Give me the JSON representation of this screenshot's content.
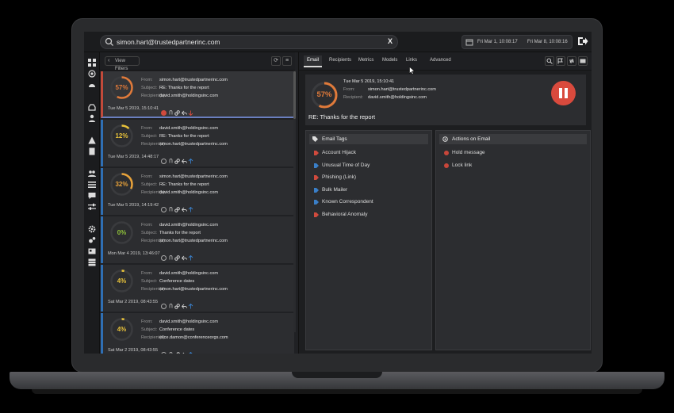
{
  "search": {
    "value": "simon.hart@trustedpartnerinc.com",
    "clear_label": "X"
  },
  "date_range": {
    "from": "Fri Mar 1, 10:08:17",
    "to": "Fri Mar 8, 10:08:16"
  },
  "list": {
    "filter_label": "View Filters",
    "refresh_label": "⟳",
    "menu_label": "≡",
    "labels": {
      "from": "From:",
      "subject": "Subject:",
      "recipients": "Recipient(s):"
    },
    "emails": [
      {
        "score": "57%",
        "score_value": 57,
        "color": "#e07a3a",
        "from": "simon.hart@trustedpartnerinc.com",
        "subject": "RE: Thanks for the report",
        "recipients": "david.smith@holdingsinc.com",
        "date": "Tue Mar 5 2019, 15:10:41"
      },
      {
        "score": "12%",
        "score_value": 12,
        "color": "#e8c23a",
        "from": "david.smith@holdingsinc.com",
        "subject": "RE: Thanks for the report",
        "recipients": "simon.hart@trustedpartnerinc.com",
        "date": "Tue Mar 5 2019, 14:48:17"
      },
      {
        "score": "32%",
        "score_value": 32,
        "color": "#e8a23a",
        "from": "simon.hart@trustedpartnerinc.com",
        "subject": "RE: Thanks for the report",
        "recipients": "david.smith@holdingsinc.com",
        "date": "Tue Mar 5 2019, 14:19:42"
      },
      {
        "score": "0%",
        "score_value": 0,
        "color": "#8fc23a",
        "from": "david.smith@holdingsinc.com",
        "subject": "Thanks for the report",
        "recipients": "simon.hart@trustedpartnerinc.com",
        "date": "Mon Mar 4 2019, 13:46:07"
      },
      {
        "score": "4%",
        "score_value": 4,
        "color": "#e8c23a",
        "from": "david.smith@holdingsinc.com",
        "subject": "Conference dates",
        "recipients": "simon.hart@trustedpartnerinc.com",
        "date": "Sat Mar 2 2019, 08:43:55"
      },
      {
        "score": "4%",
        "score_value": 4,
        "color": "#e8c23a",
        "from": "david.smith@holdingsinc.com",
        "subject": "Conference dates",
        "recipients": "elice.damon@conferenceorgs.com",
        "date": "Sat Mar 2 2019, 08:43:55"
      }
    ]
  },
  "tabs": [
    "Email",
    "Recipients",
    "Metrics",
    "Models",
    "Links",
    "Advanced"
  ],
  "detail": {
    "score": "57%",
    "score_value": 57,
    "date": "Tue Mar 5 2019, 15:10:41",
    "from_label": "From:",
    "from": "simon.hart@trustedpartnerinc.com",
    "recipient_label": "Recipient:",
    "recipient": "david.smith@holdingsinc.com",
    "subject": "RE: Thanks for the report"
  },
  "email_tags": {
    "title": "Email Tags",
    "items": [
      {
        "label": "Account Hijack",
        "color": "#d04a3d"
      },
      {
        "label": "Unusual Time of Day",
        "color": "#3a7fc8"
      },
      {
        "label": "Phishing (Link)",
        "color": "#d04a3d"
      },
      {
        "label": "Bulk Mailer",
        "color": "#3a7fc8"
      },
      {
        "label": "Known Correspondent",
        "color": "#3a7fc8"
      },
      {
        "label": "Behavioral Anomaly",
        "color": "#d04a3d"
      }
    ]
  },
  "actions": {
    "title": "Actions on Email",
    "items": [
      {
        "label": "Hold message"
      },
      {
        "label": "Lock link"
      }
    ]
  },
  "colors": {
    "accent_red": "#d94a3d",
    "accent_blue": "#2f6fb4"
  }
}
